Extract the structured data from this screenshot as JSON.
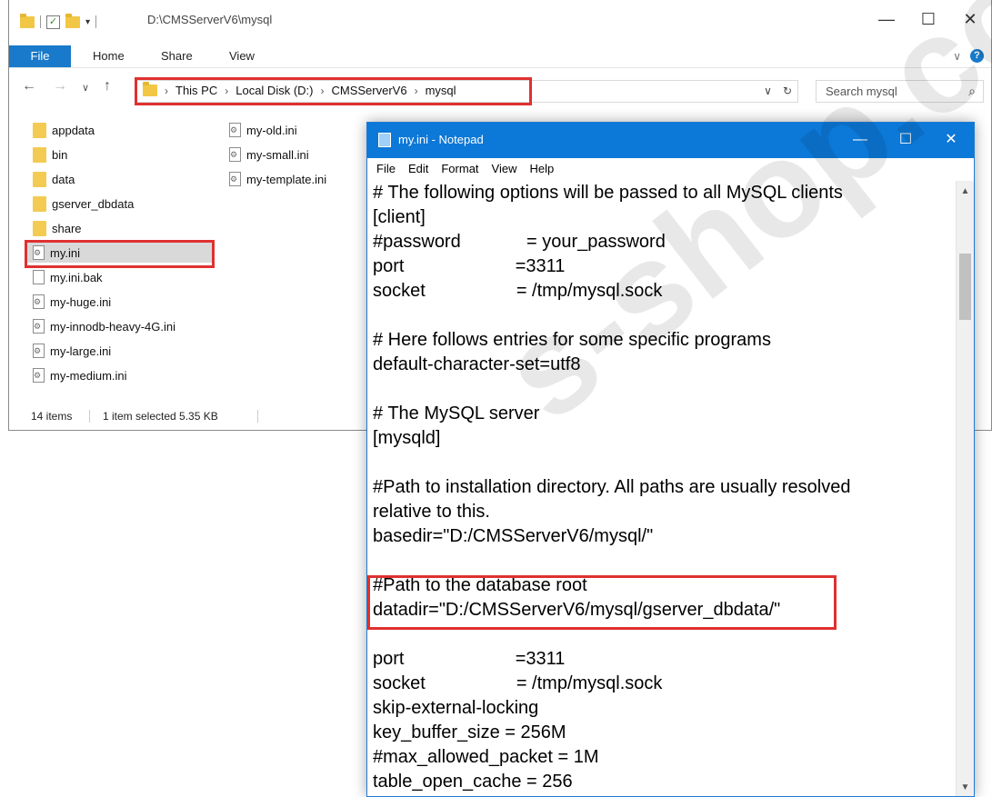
{
  "explorer": {
    "title_path": "D:\\CMSServerV6\\mysql",
    "controls": {
      "minimize": "—",
      "maximize": "☐",
      "close": "✕"
    },
    "ribbon": {
      "file": "File",
      "tabs": [
        "Home",
        "Share",
        "View"
      ]
    },
    "breadcrumb": [
      "This PC",
      "Local Disk (D:)",
      "CMSServerV6",
      "mysql"
    ],
    "search_placeholder": "Search mysql",
    "files_col1": [
      {
        "name": "appdata",
        "type": "folder"
      },
      {
        "name": "bin",
        "type": "folder"
      },
      {
        "name": "data",
        "type": "folder"
      },
      {
        "name": "gserver_dbdata",
        "type": "folder"
      },
      {
        "name": "share",
        "type": "folder"
      },
      {
        "name": "my.ini",
        "type": "config",
        "selected": true
      },
      {
        "name": "my.ini.bak",
        "type": "file"
      },
      {
        "name": "my-huge.ini",
        "type": "config"
      },
      {
        "name": "my-innodb-heavy-4G.ini",
        "type": "config"
      },
      {
        "name": "my-large.ini",
        "type": "config"
      },
      {
        "name": "my-medium.ini",
        "type": "config"
      }
    ],
    "files_col2": [
      {
        "name": "my-old.ini",
        "type": "config"
      },
      {
        "name": "my-small.ini",
        "type": "config"
      },
      {
        "name": "my-template.ini",
        "type": "config"
      }
    ],
    "status": {
      "items": "14 items",
      "selected": "1 item selected  5.35 KB"
    }
  },
  "notepad": {
    "title": "my.ini - Notepad",
    "menu": [
      "File",
      "Edit",
      "Format",
      "View",
      "Help"
    ],
    "lines": [
      "# The following options will be passed to all MySQL clients",
      "[client]",
      "#password             = your_password",
      "port                      =3311",
      "socket                  = /tmp/mysql.sock",
      "",
      "# Here follows entries for some specific programs",
      "default-character-set=utf8",
      "",
      "# The MySQL server",
      "[mysqld]",
      "",
      "#Path to installation directory. All paths are usually resolved",
      "relative to this.",
      "basedir=\"D:/CMSServerV6/mysql/\"",
      "",
      "#Path to the database root",
      "datadir=\"D:/CMSServerV6/mysql/gserver_dbdata/\"",
      "",
      "port                      =3311",
      "socket                  = /tmp/mysql.sock",
      "skip-external-locking",
      "key_buffer_size = 256M",
      "#max_allowed_packet = 1M",
      "table_open_cache = 256"
    ]
  },
  "watermark": "s-shop.co",
  "colors": {
    "accent": "#0c78d7",
    "highlight": "#e03030",
    "folder": "#f4cb52"
  }
}
